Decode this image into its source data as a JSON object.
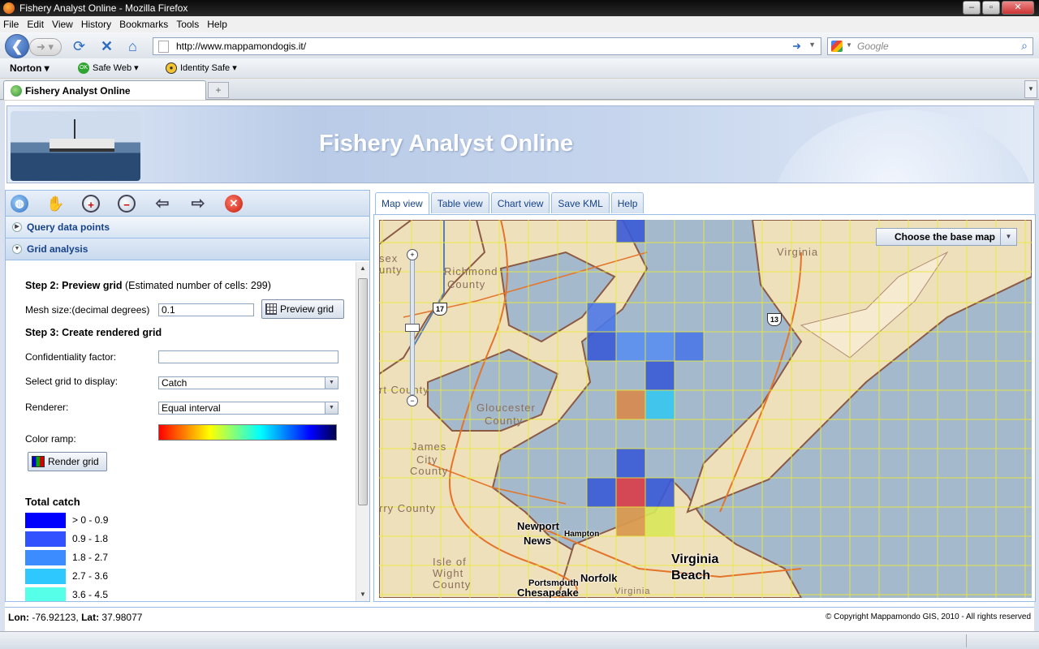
{
  "window": {
    "title": "Fishery Analyst Online - Mozilla Firefox",
    "min_label": "–",
    "max_label": "▫",
    "close_label": "✕"
  },
  "menu": [
    "File",
    "Edit",
    "View",
    "History",
    "Bookmarks",
    "Tools",
    "Help"
  ],
  "nav": {
    "url": "http://www.mappamondogis.it/",
    "search_placeholder": "Google"
  },
  "norton": {
    "brand": "Norton",
    "safe_web": "Safe Web",
    "safe_web_badge": "OK",
    "identity_safe": "Identity Safe"
  },
  "browser_tabs": [
    {
      "label": "Fishery Analyst Online"
    }
  ],
  "banner": {
    "title": "Fishery Analyst Online"
  },
  "toolbar": {
    "icons": [
      "globe-icon",
      "pan-hand-icon",
      "zoom-in-icon",
      "zoom-out-icon",
      "previous-extent-icon",
      "next-extent-icon",
      "clear-icon"
    ]
  },
  "accordion": {
    "query_label": "Query data points",
    "grid_label": "Grid analysis"
  },
  "grid_form": {
    "step2_title": "Step 2: Preview grid",
    "step2_note": "(Estimated number of cells: 299)",
    "mesh_label": "Mesh size:(decimal degrees)",
    "mesh_value": "0.1",
    "preview_button": "Preview grid",
    "step3_title": "Step 3: Create rendered grid",
    "confidentiality_label": "Confidentiality factor:",
    "confidentiality_value": "",
    "grid_select_label": "Select grid to display:",
    "grid_select_value": "Catch",
    "renderer_label": "Renderer:",
    "renderer_value": "Equal interval",
    "color_ramp_label": "Color ramp:",
    "render_button": "Render grid"
  },
  "legend": {
    "title": "Total catch",
    "items": [
      {
        "label": "> 0 - 0.9",
        "color": "#0000ff"
      },
      {
        "label": "0.9 - 1.8",
        "color": "#3052ff"
      },
      {
        "label": "1.8 - 2.7",
        "color": "#3c8cff"
      },
      {
        "label": "2.7 - 3.6",
        "color": "#2ec8ff"
      },
      {
        "label": "3.6 - 4.5",
        "color": "#56ffe8"
      }
    ]
  },
  "map_tabs": [
    "Map view",
    "Table view",
    "Chart view",
    "Save KML",
    "Help"
  ],
  "map": {
    "base_map_button": "Choose the base map",
    "labels": {
      "virginia": "Virginia",
      "richmond": "Richmond",
      "county1": "County",
      "sex": "sex",
      "unty": "unty",
      "rt_county": "rt County",
      "gloucester": "Gloucester",
      "county2": "County",
      "james": "James",
      "city": "City",
      "county3": "County",
      "rry_county": "rry County",
      "newport": "Newport",
      "news": "News",
      "hampton": "Hampton",
      "isle_of": "Isle of",
      "wight": "Wight",
      "county4": "County",
      "portsmouth": "Portsmouth",
      "norfolk": "Norfolk",
      "chesapeake": "Chesapeake",
      "virginia_small": "Virginia",
      "virginia_beach1": "Virginia",
      "virginia_beach2": "Beach"
    },
    "route_17": "17",
    "route_13": "13"
  },
  "status": {
    "lon_label": "Lon:",
    "lon_value": "-76.92123",
    "lat_label": "Lat:",
    "lat_value": "37.98077",
    "copyright": "© Copyright Mappamondo GIS, 2010 - All rights reserved"
  }
}
